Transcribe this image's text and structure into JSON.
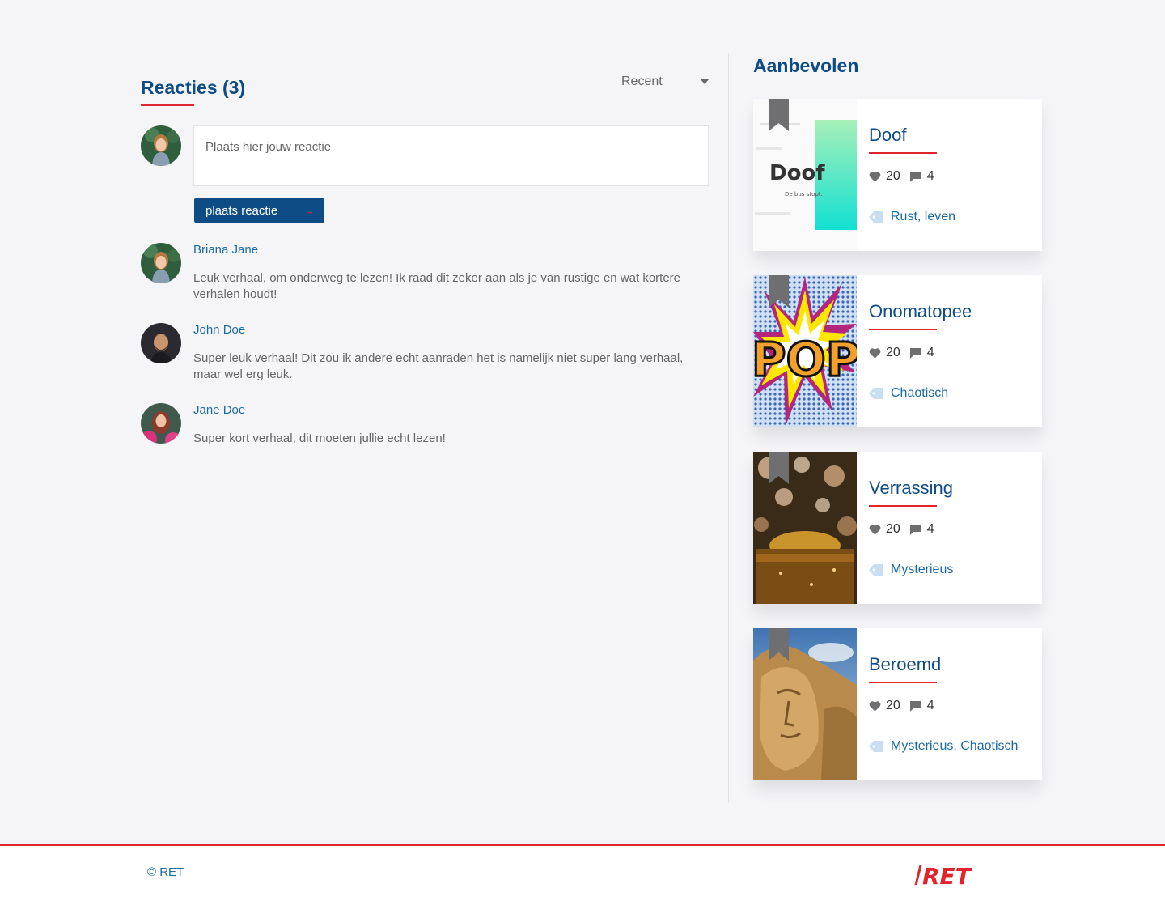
{
  "comments": {
    "title": "Reacties (3)",
    "sort": {
      "selected": "Recent"
    },
    "reply_placeholder": "Plaats hier jouw reactie",
    "submit_label": "plaats reactie",
    "items": [
      {
        "author": "Briana Jane",
        "text": "Leuk verhaal, om onderweg te lezen! Ik raad dit zeker aan als je van rustige en wat kortere verhalen houdt!"
      },
      {
        "author": "John Doe",
        "text": "Super leuk verhaal! Dit zou ik andere echt aanraden het is namelijk niet super lang verhaal, maar wel erg leuk."
      },
      {
        "author": "Jane Doe",
        "text": "Super kort verhaal, dit moeten jullie echt lezen!"
      }
    ]
  },
  "recommended": {
    "title": "Aanbevolen",
    "cards": [
      {
        "title": "Doof",
        "likes": "20",
        "comments": "4",
        "tags": "Rust, leven",
        "thumb_text": "Doof",
        "thumb_subtext": "De bus stopt."
      },
      {
        "title": "Onomatopee",
        "likes": "20",
        "comments": "4",
        "tags": "Chaotisch",
        "thumb_text": "POP"
      },
      {
        "title": "Verrassing",
        "likes": "20",
        "comments": "4",
        "tags": "Mysterieus"
      },
      {
        "title": "Beroemd",
        "likes": "20",
        "comments": "4",
        "tags": "Mysterieus, Chaotisch"
      }
    ]
  },
  "footer": {
    "copyright": "© RET",
    "logo_text": "RET"
  },
  "colors": {
    "brand_blue": "#0e4c86",
    "link_blue": "#1a6aa3",
    "accent_red": "#e2242f",
    "background": "#f5f5f8"
  },
  "icons": [
    "caret-down-icon",
    "arrow-right-icon",
    "bookmark-icon",
    "heart-icon",
    "comment-icon",
    "tag-icon"
  ]
}
